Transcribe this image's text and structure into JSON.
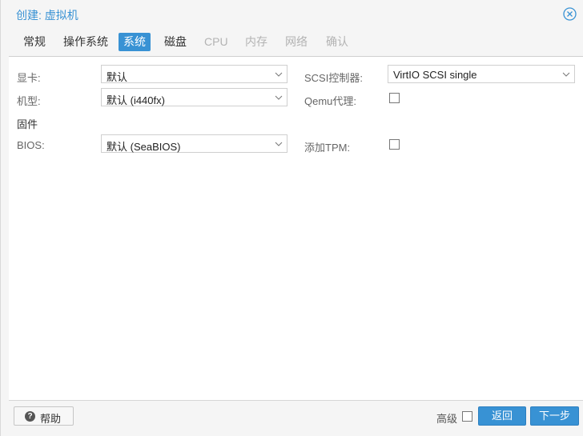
{
  "dialog": {
    "title": "创建: 虚拟机"
  },
  "tabs": [
    {
      "label": "常规",
      "state": "normal"
    },
    {
      "label": "操作系统",
      "state": "normal"
    },
    {
      "label": "系统",
      "state": "active"
    },
    {
      "label": "磁盘",
      "state": "normal"
    },
    {
      "label": "CPU",
      "state": "disabled"
    },
    {
      "label": "内存",
      "state": "disabled"
    },
    {
      "label": "网络",
      "state": "disabled"
    },
    {
      "label": "确认",
      "state": "disabled"
    }
  ],
  "form": {
    "display": {
      "label": "显卡:",
      "value": "默认"
    },
    "machine": {
      "label": "机型:",
      "value": "默认 (i440fx)"
    },
    "firmware_section": "固件",
    "bios": {
      "label": "BIOS:",
      "value": "默认 (SeaBIOS)"
    },
    "scsi": {
      "label": "SCSI控制器:",
      "value": "VirtIO SCSI single"
    },
    "qemu_agent": {
      "label": "Qemu代理:",
      "checked": false
    },
    "tpm": {
      "label": "添加TPM:",
      "checked": false
    }
  },
  "footer": {
    "help_label": "帮助",
    "advanced_label": "高级",
    "advanced_checked": false,
    "back_label": "返回",
    "next_label": "下一步"
  },
  "colors": {
    "accent": "#3892d4",
    "disabled_text": "#b3b3b3"
  },
  "icons": {
    "close": "close-icon",
    "help": "question-circle-icon",
    "dropdown": "chevron-down-icon"
  }
}
